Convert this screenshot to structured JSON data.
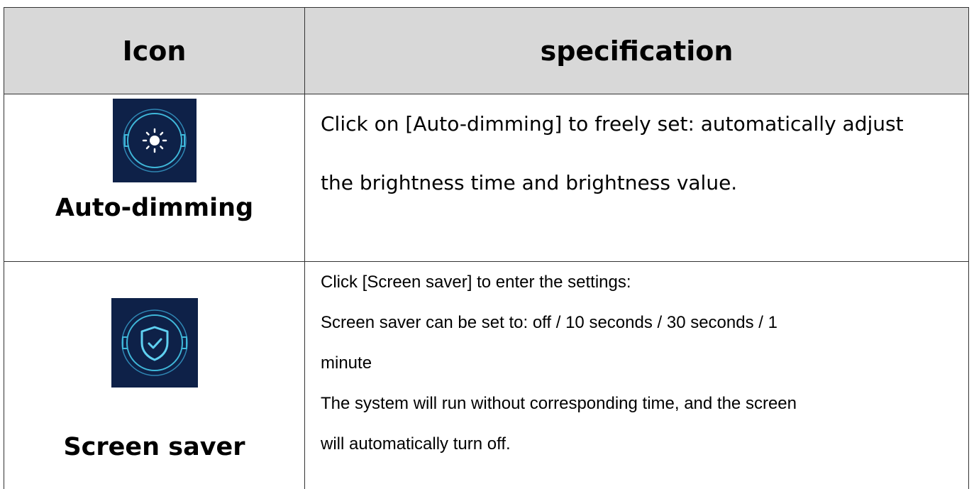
{
  "table": {
    "header": {
      "icon": "Icon",
      "specification": "specification"
    },
    "rows": [
      {
        "icon_name": "brightness-icon",
        "label": "Auto-dimming",
        "spec_lines": [
          "Click on [Auto-dimming] to freely set: automatically adjust",
          "the brightness time and brightness value."
        ]
      },
      {
        "icon_name": "shield-check-icon",
        "label": "Screen saver",
        "spec_lines": [
          "Click [Screen saver] to enter the settings:",
          "Screen saver can be set to: off / 10 seconds / 30 seconds / 1",
          "minute",
          "The system will run without corresponding time, and the screen",
          "will automatically turn off."
        ]
      }
    ]
  },
  "colors": {
    "header_bg": "#d8d8d8",
    "icon_bg": "#0e2148",
    "icon_stroke": "#3fb7d9"
  }
}
